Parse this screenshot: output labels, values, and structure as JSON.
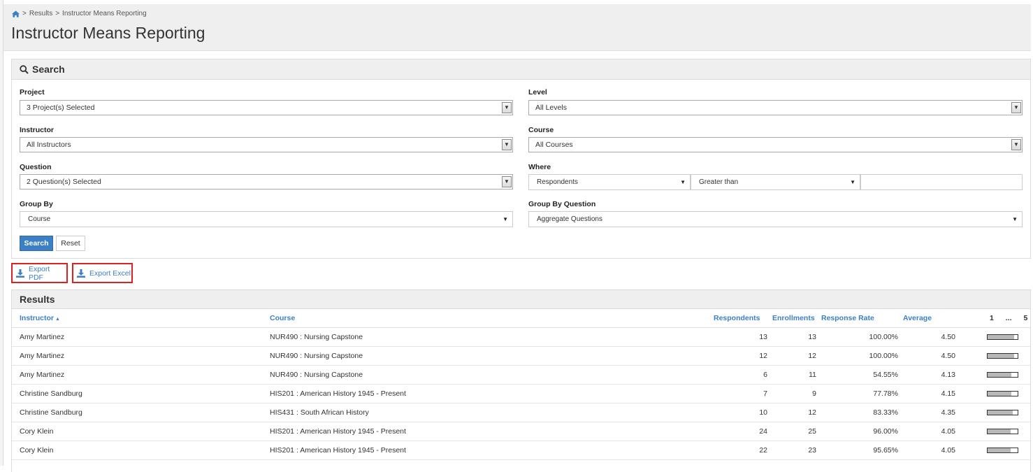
{
  "breadcrumb": {
    "items": [
      "Results",
      "Instructor Means Reporting"
    ],
    "separator": ">"
  },
  "page": {
    "title": "Instructor Means Reporting"
  },
  "search": {
    "heading": "Search",
    "project": {
      "label": "Project",
      "value": "3 Project(s) Selected"
    },
    "level": {
      "label": "Level",
      "value": "All Levels"
    },
    "instructor": {
      "label": "Instructor",
      "value": "All Instructors"
    },
    "course": {
      "label": "Course",
      "value": "All Courses"
    },
    "question": {
      "label": "Question",
      "value": "2 Question(s) Selected"
    },
    "where": {
      "label": "Where",
      "field": "Respondents",
      "operator": "Greater than",
      "value": ""
    },
    "group_by": {
      "label": "Group By",
      "value": "Course"
    },
    "group_by_question": {
      "label": "Group By Question",
      "value": "Aggregate Questions"
    },
    "search_button": "Search",
    "reset_button": "Reset"
  },
  "exports": {
    "pdf": "Export PDF",
    "excel": "Export Excel"
  },
  "results": {
    "heading": "Results",
    "columns": {
      "instructor": "Instructor",
      "course": "Course",
      "respondents": "Respondents",
      "enrollments": "Enrollments",
      "response_rate": "Response Rate",
      "average": "Average",
      "scale_min": "1",
      "scale_mid": "...",
      "scale_max": "5"
    },
    "rows": [
      {
        "instructor": "Amy Martinez",
        "course": "NUR490 : Nursing Capstone",
        "respondents": "13",
        "enrollments": "13",
        "response_rate": "100.00%",
        "average": "4.50",
        "avg_value": 4.5
      },
      {
        "instructor": "Amy Martinez",
        "course": "NUR490 : Nursing Capstone",
        "respondents": "12",
        "enrollments": "12",
        "response_rate": "100.00%",
        "average": "4.50",
        "avg_value": 4.5
      },
      {
        "instructor": "Amy Martinez",
        "course": "NUR490 : Nursing Capstone",
        "respondents": "6",
        "enrollments": "11",
        "response_rate": "54.55%",
        "average": "4.13",
        "avg_value": 4.13
      },
      {
        "instructor": "Christine Sandburg",
        "course": "HIS201 : American History 1945 - Present",
        "respondents": "7",
        "enrollments": "9",
        "response_rate": "77.78%",
        "average": "4.15",
        "avg_value": 4.15
      },
      {
        "instructor": "Christine Sandburg",
        "course": "HIS431 : South African History",
        "respondents": "10",
        "enrollments": "12",
        "response_rate": "83.33%",
        "average": "4.35",
        "avg_value": 4.35
      },
      {
        "instructor": "Cory Klein",
        "course": "HIS201 : American History 1945 - Present",
        "respondents": "24",
        "enrollments": "25",
        "response_rate": "96.00%",
        "average": "4.05",
        "avg_value": 4.05
      },
      {
        "instructor": "Cory Klein",
        "course": "HIS201 : American History 1945 - Present",
        "respondents": "22",
        "enrollments": "23",
        "response_rate": "95.65%",
        "average": "4.05",
        "avg_value": 4.05
      }
    ]
  },
  "colors": {
    "accent": "#3b7fc4",
    "highlight_border": "#e02020",
    "header_bg": "#efefef"
  },
  "icons": {
    "home": "home-icon",
    "search": "search-icon",
    "export": "download-icon",
    "dropdown": "chevron-down-icon"
  }
}
